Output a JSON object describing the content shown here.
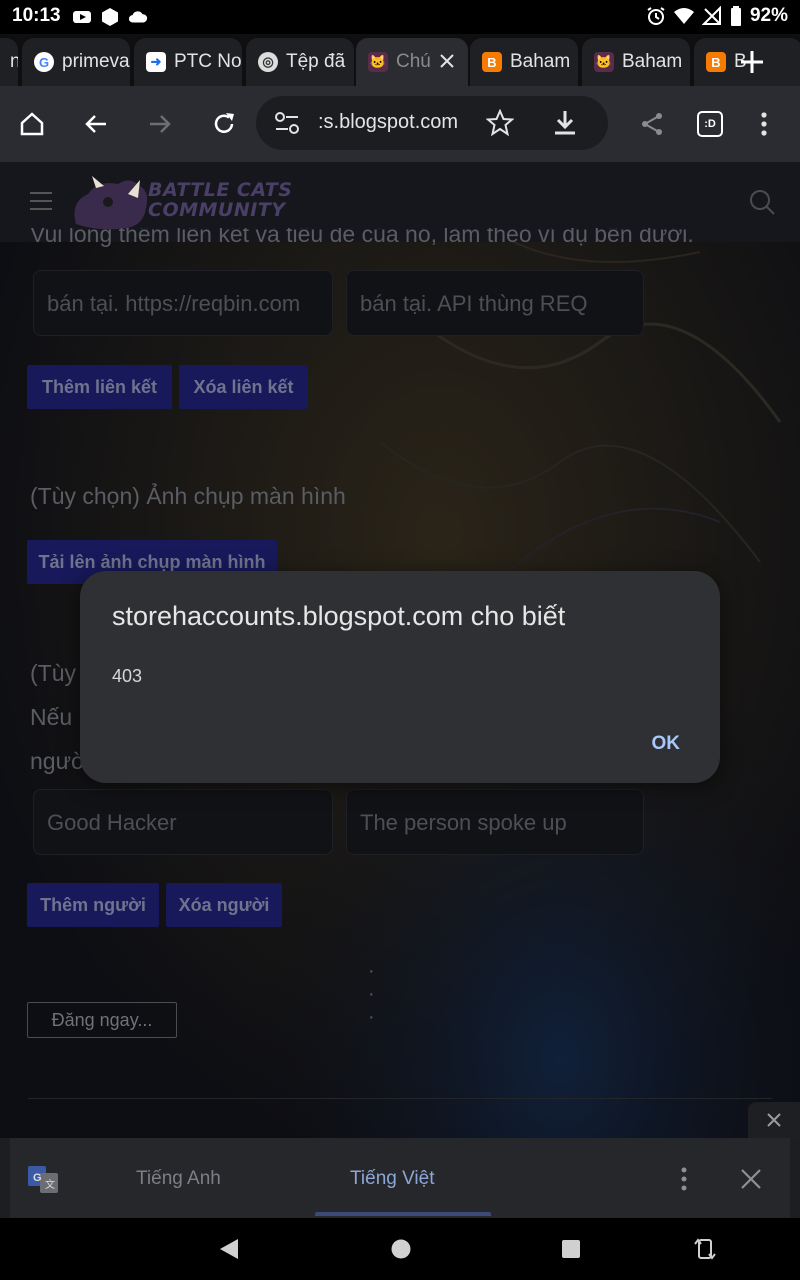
{
  "status_bar": {
    "time": "10:13",
    "battery": "92%"
  },
  "tabs": [
    {
      "title": "primeva",
      "favicon": "google-g-icon",
      "active": false
    },
    {
      "title": "PTC No",
      "favicon": "ptc-icon",
      "active": false
    },
    {
      "title": "Tệp đã",
      "favicon": "chrome-icon",
      "active": false
    },
    {
      "title": "Chú",
      "favicon": "cat-icon",
      "active": true
    },
    {
      "title": "Baham",
      "favicon": "blogger-icon",
      "active": false
    },
    {
      "title": "Baham",
      "favicon": "cat-icon",
      "active": false
    },
    {
      "title": "B",
      "favicon": "blogger-icon",
      "active": false
    }
  ],
  "toolbar": {
    "url": ":s.blogspot.com",
    "tab_count": ":D"
  },
  "page": {
    "logo_line1": "BATTLE CATS",
    "logo_line2": "COMMUNITY",
    "instruction": "Vui lòng thêm liên kết và tiêu đề của nó, làm theo ví dụ bên dưới.",
    "link_inputs": [
      {
        "placeholder": "bán tại.  https://reqbin.com"
      },
      {
        "placeholder": "bán tại.  API thùng REQ"
      }
    ],
    "add_link_label": "Thêm liên kết",
    "remove_link_label": "Xóa liên kết",
    "screenshot_heading": "(Tùy chọn) Ảnh chụp màn hình",
    "upload_label": "Tải lên ảnh chụp màn hình",
    "optional_heading_partial": "(Tùy",
    "line2_partial": "Nếu",
    "line3_partial": "ngườ",
    "people_inputs": [
      {
        "value": "Good Hacker"
      },
      {
        "value": "The person spoke up"
      }
    ],
    "add_person_label": "Thêm người",
    "remove_person_label": "Xóa người",
    "ellipsis": "· · ·",
    "publish_label": "Đăng ngay..."
  },
  "dialog": {
    "title": "storehaccounts.blogspot.com cho biết",
    "message": "403",
    "ok_label": "OK"
  },
  "translate_bar": {
    "source_language": "Tiếng Anh",
    "target_language": "Tiếng Việt"
  },
  "colors": {
    "dialog_bg": "#2f3033",
    "ok_accent": "#a8c7fa",
    "page_button": "#17195a"
  }
}
